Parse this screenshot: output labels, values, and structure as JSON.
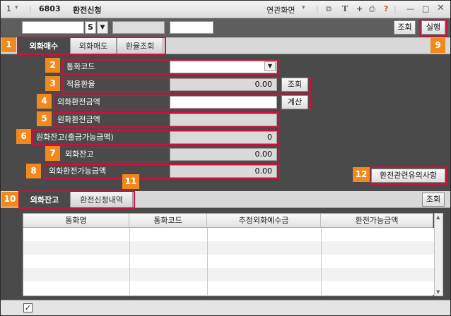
{
  "titlebar": {
    "num": "1",
    "screen_code": "6803",
    "title": "환전신청",
    "linked_screen": "연관화면"
  },
  "toolbar": {
    "account_type": "S",
    "query_label": "조회",
    "execute_label": "실행"
  },
  "tabs_top": [
    {
      "label": "외화매수"
    },
    {
      "label": "외화매도"
    },
    {
      "label": "환율조회"
    }
  ],
  "form": {
    "currency_code_label": "통화코드",
    "applied_rate_label": "적용환율",
    "applied_rate_value": "0.00",
    "rate_query_label": "조회",
    "fx_amount_label": "외화환전금액",
    "calc_label": "계산",
    "krw_amount_label": "원화환전금액",
    "krw_balance_label": "원화잔고(출금가능금액)",
    "krw_balance_value": "0",
    "fx_balance_label": "외화잔고",
    "fx_balance_value": "0.00",
    "fx_available_label": "외화환전가능금액",
    "fx_available_value": "0.00",
    "notice_label": "환전관련유의사항"
  },
  "tabs_bottom": [
    {
      "label": "외화잔고"
    },
    {
      "label": "환전신청내역"
    }
  ],
  "bottom_query_label": "조회",
  "grid": {
    "columns": [
      "통화명",
      "통화코드",
      "추정외화예수금",
      "환전가능금액"
    ]
  },
  "badges": [
    "1",
    "2",
    "3",
    "4",
    "5",
    "6",
    "7",
    "8",
    "9",
    "10",
    "11",
    "12"
  ],
  "colors": {
    "badge": "#f08a1e",
    "highlight": "#d0103a",
    "panel": "#4a4a4a"
  }
}
